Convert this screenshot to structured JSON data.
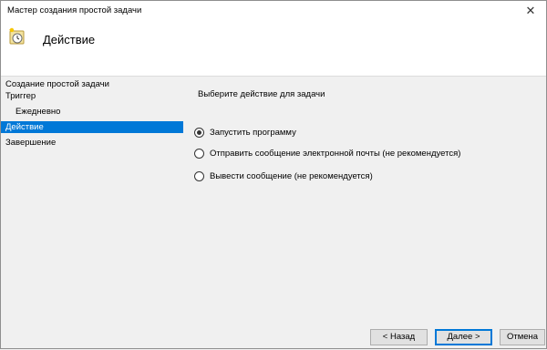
{
  "window": {
    "title": "Мастер создания простой задачи",
    "close_glyph": "✕"
  },
  "header": {
    "title": "Действие",
    "icon": "scheduled-task-clock-icon"
  },
  "steps": [
    {
      "label": "Создание простой задачи",
      "active": false,
      "sub": false
    },
    {
      "label": "Триггер",
      "active": false,
      "sub": false
    },
    {
      "label": "Ежедневно",
      "active": false,
      "sub": true
    },
    {
      "label": "Действие",
      "active": true,
      "sub": false
    },
    {
      "label": "Завершение",
      "active": false,
      "sub": false
    }
  ],
  "content": {
    "section_label": "Выберите действие для задачи",
    "options": [
      {
        "label": "Запустить программу",
        "checked": true
      },
      {
        "label": "Отправить сообщение электронной почты (не рекомендуется)",
        "checked": false
      },
      {
        "label": "Вывести сообщение (не рекомендуется)",
        "checked": false
      }
    ]
  },
  "buttons": {
    "back": "< Назад",
    "next": "Далее >",
    "cancel": "Отмена"
  },
  "colors": {
    "accent": "#0078d7",
    "window_bg": "#f0f0f0",
    "header_bg": "#ffffff"
  }
}
